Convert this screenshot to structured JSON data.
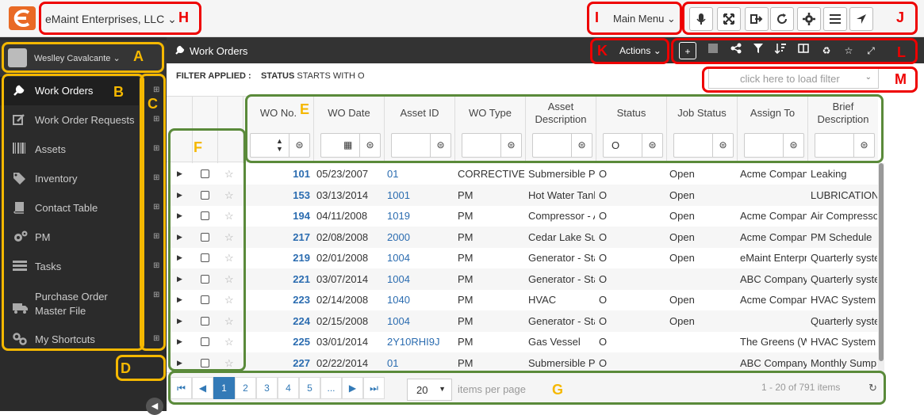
{
  "header": {
    "company": "eMaint Enterprises, LLC",
    "main_menu": "Main Menu",
    "toolbar_icons": [
      "microphone-icon",
      "fullscreen-icon",
      "logout-icon",
      "refresh-icon",
      "settings-icon",
      "menu-icon",
      "navigate-icon"
    ]
  },
  "sidebar": {
    "user": "Weslley Cavalcante",
    "items": [
      {
        "label": "Work Orders",
        "icon": "wrench-icon"
      },
      {
        "label": "Work Order Requests",
        "icon": "edit-icon"
      },
      {
        "label": "Assets",
        "icon": "barcode-icon"
      },
      {
        "label": "Inventory",
        "icon": "tags-icon"
      },
      {
        "label": "Contact Table",
        "icon": "book-icon"
      },
      {
        "label": "PM",
        "icon": "gears-icon"
      },
      {
        "label": "Tasks",
        "icon": "tasks-icon"
      },
      {
        "label": "Purchase Order Master File",
        "icon": "truck-icon"
      },
      {
        "label": "My Shortcuts",
        "icon": "link-icon"
      }
    ]
  },
  "page": {
    "title": "Work Orders",
    "actions": "Actions",
    "filter_label": "FILTER APPLIED :",
    "filter_field": "STATUS",
    "filter_rest": "STARTS WITH O",
    "load_filter_placeholder": "click here to load filter"
  },
  "grid": {
    "columns": [
      "WO No.",
      "WO Date",
      "Asset ID",
      "WO Type",
      "Asset Description",
      "Status",
      "Job Status",
      "Assign To",
      "Brief Description"
    ],
    "status_filter_value": "O",
    "rows": [
      [
        "101",
        "05/23/2007",
        "01",
        "CORRECTIVE",
        "Submersible Pump",
        "O",
        "Open",
        "Acme Company",
        "Leaking"
      ],
      [
        "153",
        "03/13/2014",
        "1001",
        "PM",
        "Hot Water Tank",
        "O",
        "Open",
        "",
        "LUBRICATION"
      ],
      [
        "194",
        "04/11/2008",
        "1019",
        "PM",
        "Compressor - Air",
        "O",
        "Open",
        "Acme Company",
        "Air Compressor"
      ],
      [
        "217",
        "02/08/2008",
        "2000",
        "PM",
        "Cedar Lake Sub",
        "O",
        "Open",
        "Acme Company",
        "PM Schedule"
      ],
      [
        "219",
        "02/01/2008",
        "1004",
        "PM",
        "Generator - Standby",
        "O",
        "Open",
        "eMaint Enterprises",
        "Quarterly system"
      ],
      [
        "221",
        "03/07/2014",
        "1004",
        "PM",
        "Generator - Standby",
        "O",
        "",
        "ABC Company",
        "Quarterly system"
      ],
      [
        "223",
        "02/14/2008",
        "1040",
        "PM",
        "HVAC",
        "O",
        "Open",
        "Acme Company",
        "HVAC System"
      ],
      [
        "224",
        "02/15/2008",
        "1004",
        "PM",
        "Generator - Standby",
        "O",
        "Open",
        "",
        "Quarterly system"
      ],
      [
        "225",
        "03/01/2014",
        "2Y10RHI9J",
        "PM",
        "Gas Vessel",
        "O",
        "",
        "The Greens (W)",
        "HVAC System"
      ],
      [
        "227",
        "02/22/2014",
        "01",
        "PM",
        "Submersible Pump",
        "O",
        "",
        "ABC Company",
        "Monthly Sump"
      ]
    ]
  },
  "pager": {
    "pages": [
      "1",
      "2",
      "3",
      "4",
      "5",
      "..."
    ],
    "per_page": "20",
    "per_page_label": "items per page",
    "info": "1 - 20 of 791 items"
  },
  "annotations": [
    "A",
    "B",
    "C",
    "D",
    "E",
    "F",
    "G",
    "H",
    "I",
    "J",
    "K",
    "L",
    "M"
  ]
}
